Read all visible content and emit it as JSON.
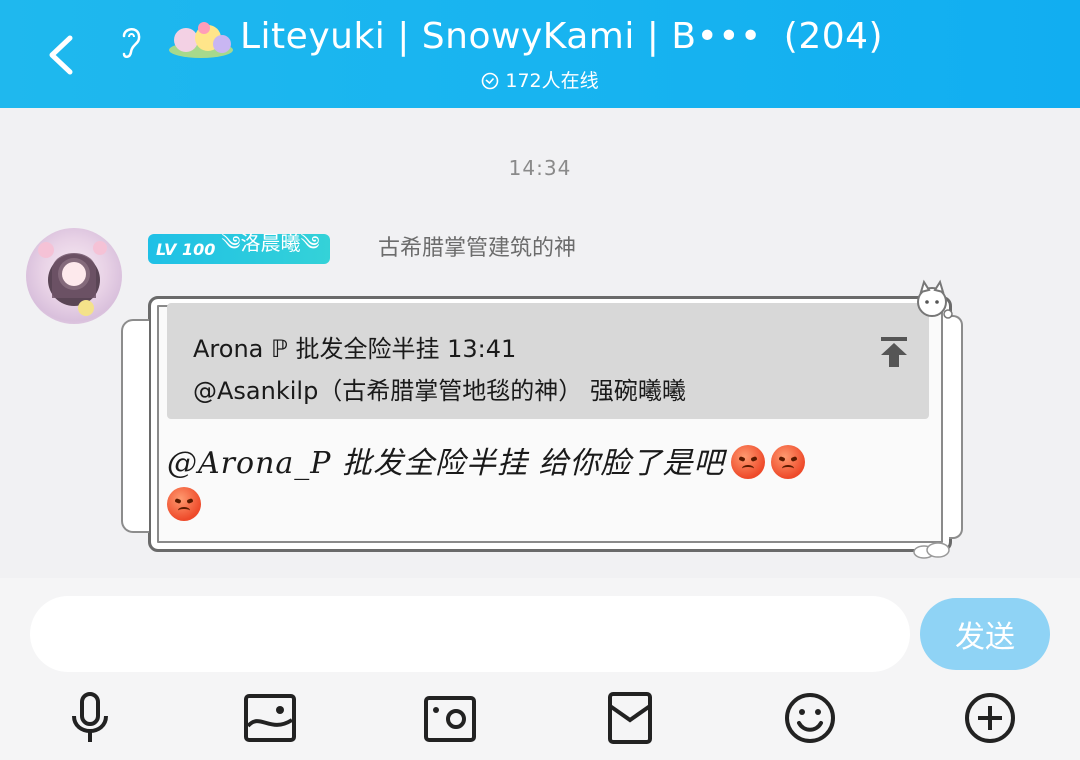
{
  "header": {
    "title": "Liteyuki | SnowyKami | B•••",
    "member_count": "(204)",
    "online": "172人在线",
    "colors": {
      "bar": "#18b4f0",
      "text": "#ffffff"
    }
  },
  "chat": {
    "timestamp": "14:34",
    "message": {
      "level": "LV 100",
      "nickname": "༄洛晨曦༄",
      "title": "古希腊掌管建筑的神",
      "quote": {
        "header": "Arona ℙ 批发全险半挂 13:41",
        "text": "@Asankilp（古希腊掌管地毯的神） 强碗曦曦"
      },
      "text": "@Arona_P 批发全险半挂 给你脸了是吧",
      "emojis": [
        "angry-face",
        "angry-face",
        "angry-face"
      ]
    }
  },
  "input": {
    "placeholder": "",
    "send_label": "发送"
  },
  "toolbar": {
    "icons": [
      "microphone-icon",
      "image-icon",
      "camera-icon",
      "red-packet-icon",
      "emoji-icon",
      "plus-icon"
    ]
  }
}
